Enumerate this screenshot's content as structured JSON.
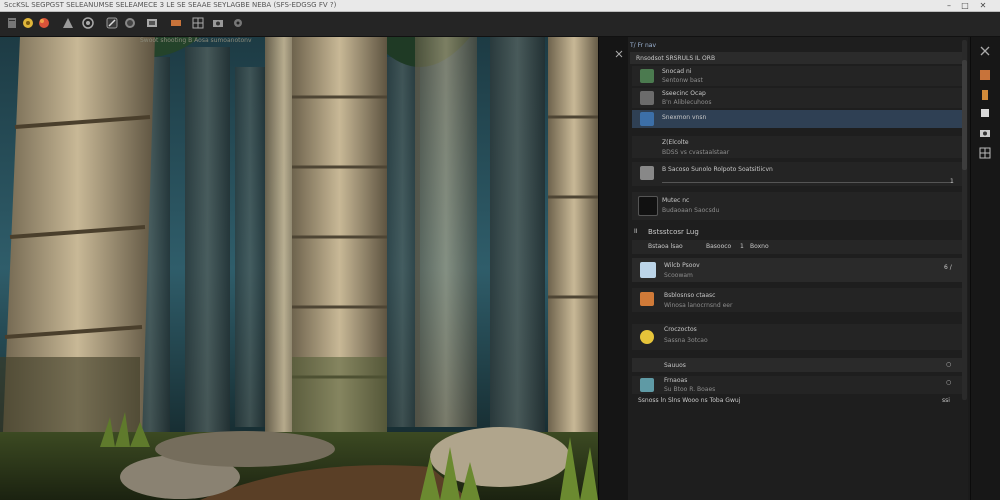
{
  "window": {
    "title": "SccKSL   SEGPGST SELEANUMSE SELEAMECE 3 LE   SE SEAAE  SEYLAGBE NEBA (SFS-EDGSG FV ?)",
    "min": "–",
    "max": "□",
    "close": "✕"
  },
  "toolbar": {
    "icons": [
      "file-icon",
      "palette-icon",
      "color-icon",
      "shape-icon",
      "mask-icon",
      "brush-icon",
      "clone-icon",
      "layer-icon",
      "transform-icon",
      "grid-icon",
      "camera-icon",
      "settings-icon"
    ]
  },
  "viewport": {
    "label": "Swoot shooting    B    Aosa sumoanotonv"
  },
  "panel": {
    "header": "T/ Fr nav",
    "section1": {
      "title": "Rnsodsot SRSRULS IL ORB",
      "items": [
        {
          "name": "Snocad ni",
          "sub": "Sentonw bast"
        },
        {
          "name": "Sseecinc Ocap",
          "sub": "B'n Aliblecuhoos"
        },
        {
          "name": "Snexmon vnsn",
          "sub": ""
        },
        {
          "name": "Z(Elcolte",
          "sub": "BDSS vs cvastaalstaar"
        },
        {
          "name": "B Sacoso Sunolo Rolpoto Soatsitiicvn",
          "sub": ""
        },
        {
          "name": "Mutec nc",
          "sub": "Budaoaan Saocsdu"
        }
      ],
      "scrub_value": "1"
    },
    "section2": {
      "index": "II",
      "title": "Bstsstcosr Lug",
      "tabs": [
        "Bstaoa lsao",
        "Basooco",
        "1",
        "Boxno"
      ],
      "items": [
        {
          "name": "Wilcb Psoov",
          "sub": "Scoowam",
          "value": "6  /"
        },
        {
          "name": "Bsblosnso ctaasc",
          "sub": "Winosa lanocrnsnd eer"
        },
        {
          "name": "Croczoctos",
          "sub": "Sassna 3otcao"
        },
        {
          "name": "Sauuos",
          "sub": "",
          "value": "○"
        },
        {
          "name": "Frnaoas",
          "sub": "Su Btoo  R. Boaes",
          "value": "○"
        }
      ],
      "footer": "Ssnoss ln Slns Wooo ns Toba Gwuj",
      "footer_value": "ssi"
    }
  },
  "rightbar": {
    "icons": [
      "close-icon",
      "layers-icon",
      "tools-icon",
      "properties-icon",
      "camera-icon",
      "grid-icon"
    ]
  },
  "colors": {
    "accent": "#3d6fb0",
    "panel_bg": "#1e1e1e",
    "titlebar_bg": "#e9e9e9"
  }
}
